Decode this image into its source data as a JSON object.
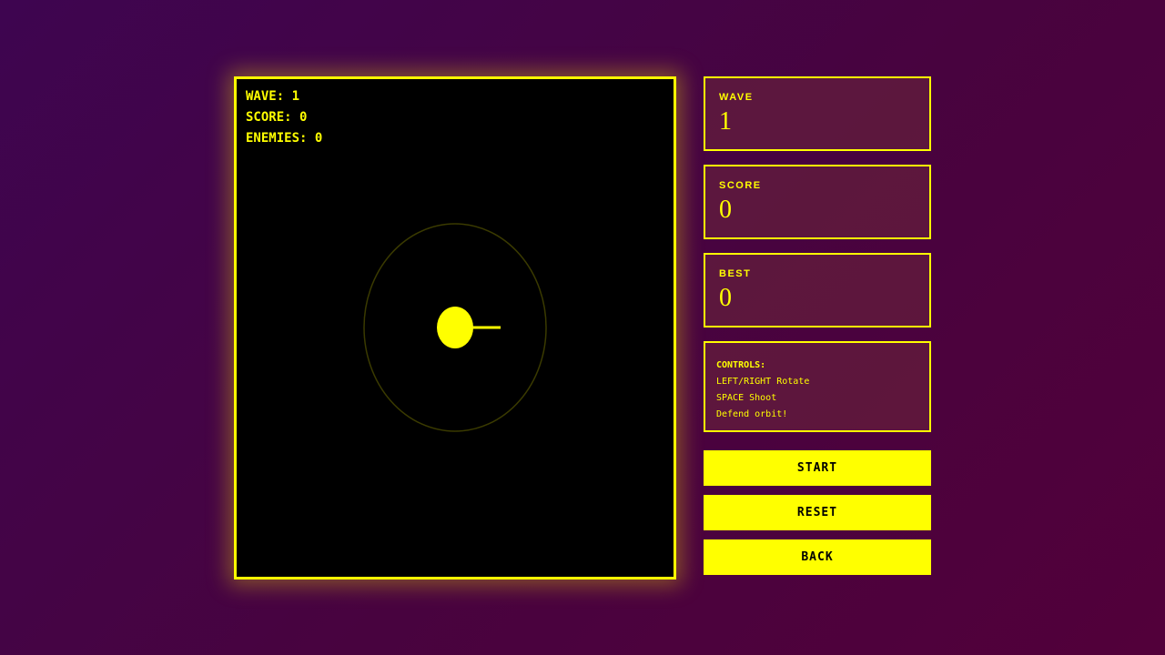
{
  "hud": {
    "wave_text": "WAVE: 1",
    "score_text": "SCORE: 0",
    "enemies_text": "ENEMIES: 0"
  },
  "stats": {
    "wave_label": "WAVE",
    "wave_value": "1",
    "score_label": "SCORE",
    "score_value": "0",
    "best_label": "BEST",
    "best_value": "0"
  },
  "controls": {
    "title": "CONTROLS:",
    "lines": [
      "LEFT/RIGHT Rotate",
      "SPACE Shoot",
      "Defend orbit!"
    ]
  },
  "buttons": {
    "start": "START",
    "reset": "RESET",
    "back": "BACK"
  },
  "colors": {
    "accent": "#ffff00",
    "board": "#000000",
    "orbit": "#3a3a00"
  },
  "game": {
    "turret_angle_deg": 0
  }
}
